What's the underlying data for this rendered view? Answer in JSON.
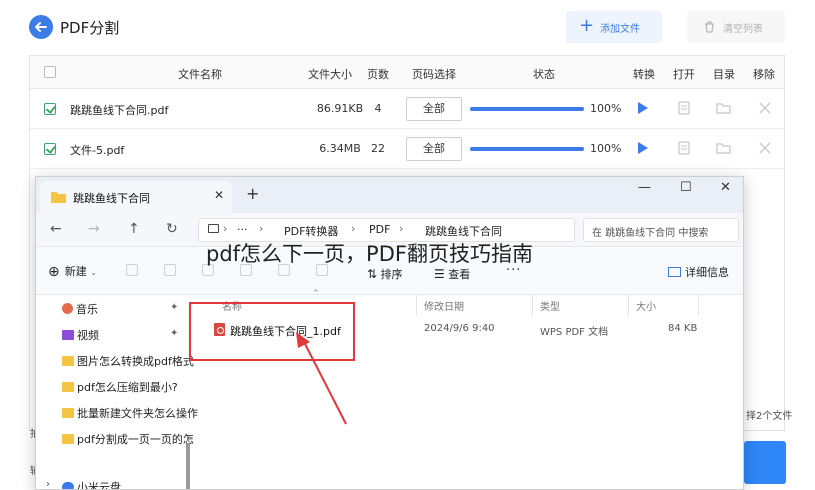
{
  "app": {
    "title": "PDF分割",
    "add_file_label": "添加文件",
    "clear_list_label": "清空列表",
    "columns": {
      "filename": "文件名称",
      "filesize": "文件大小",
      "pages": "页数",
      "page_select": "页码选择",
      "status": "状态",
      "convert": "转换",
      "open": "打开",
      "directory": "目录",
      "remove": "移除"
    },
    "rows": [
      {
        "name": "跳跳鱼线下合同.pdf",
        "size": "86.91KB",
        "pages": "4",
        "page_select": "全部",
        "progress": 100,
        "progress_label": "100%"
      },
      {
        "name": "文件-5.pdf",
        "size": "6.34MB",
        "pages": "22",
        "page_select": "全部",
        "progress": 100,
        "progress_label": "100%"
      }
    ],
    "footer_right_text": "择2个文件",
    "left_fragment_1": "抽",
    "left_fragment_2": "输",
    "accent_color": "#3b7ce9"
  },
  "explorer": {
    "tab_title": "跳跳鱼线下合同",
    "new_tab_symbol": "+",
    "window_controls": {
      "minimize": "—",
      "maximize": "☐",
      "close": "✕"
    },
    "nav": {
      "back": "←",
      "forward": "→",
      "up": "↑",
      "refresh": "↻"
    },
    "breadcrumb": [
      "PDF转换器",
      "PDF",
      "跳跳鱼线下合同"
    ],
    "breadcrumb_more": "···",
    "search_placeholder": "在 跳跳鱼线下合同 中搜索",
    "toolbar": {
      "new_label": "新建",
      "sort_label": "排序",
      "view_label": "查看",
      "more_label": "···",
      "details_label": "详细信息"
    },
    "sidebar": [
      {
        "label": "音乐",
        "pinned": true
      },
      {
        "label": "视频",
        "pinned": true
      },
      {
        "label": "图片怎么转换成pdf格式",
        "pinned": false
      },
      {
        "label": "pdf怎么压缩到最小?",
        "pinned": false
      },
      {
        "label": "批量新建文件夹怎么操作",
        "pinned": false
      },
      {
        "label": "pdf分割成一页一页的怎",
        "pinned": false
      },
      {
        "label": "小米云盘",
        "pinned": false
      }
    ],
    "pin_symbol": "📌",
    "columns": {
      "name": "名称",
      "date": "修改日期",
      "type": "类型",
      "size": "大小"
    },
    "file": {
      "name": "跳跳鱼线下合同_1.pdf",
      "date": "2024/9/6 9:40",
      "type": "WPS PDF 文档",
      "size": "84 KB"
    },
    "highlight_color": "#e0383b"
  },
  "overlay_caption": "pdf怎么下一页，PDF翻页技巧指南"
}
